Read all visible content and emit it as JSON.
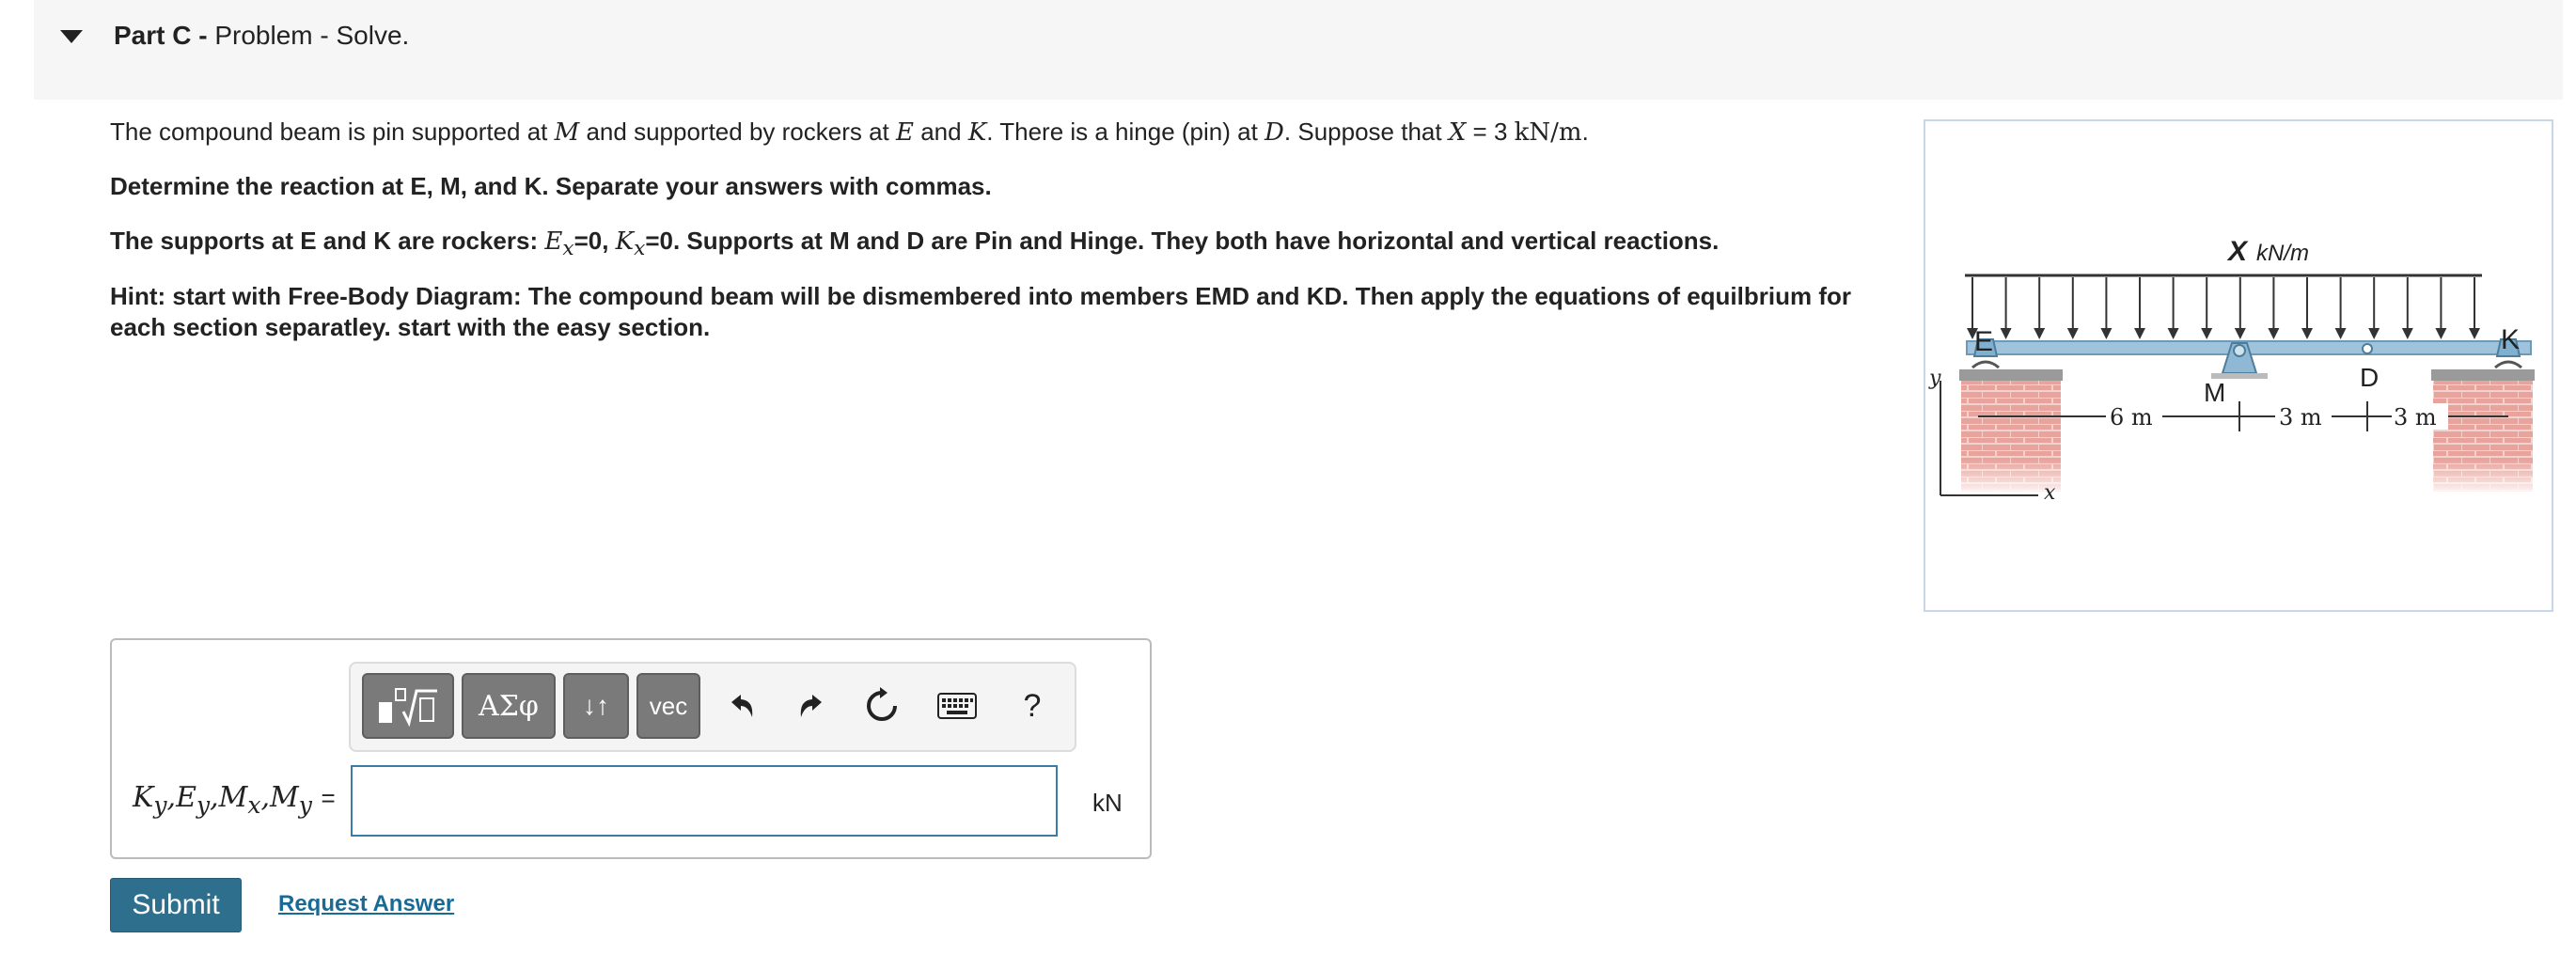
{
  "part": {
    "label": "Part C -",
    "title": "Problem - Solve."
  },
  "problem": {
    "p1_a": "The compound beam   is pin supported at ",
    "p1_M": "M",
    "p1_b": " and supported by rockers at ",
    "p1_E": "E",
    "p1_c": " and ",
    "p1_K": "K",
    "p1_d": ". There is a hinge (pin) at ",
    "p1_D": "D",
    "p1_e": ". Suppose that ",
    "p1_X": "X",
    "p1_f": " = 3 ",
    "p1_unit": "kN/m",
    "p1_g": ".",
    "p2": "Determine the reaction at E, M, and K. Separate your answers with commas.",
    "p3_a": "The supports at E and K are rockers: ",
    "p3_Ex": "E",
    "p3_Ex_sub": "x",
    "p3_b": "=0, ",
    "p3_Kx": "K",
    "p3_Kx_sub": "x",
    "p3_c": "=0. Supports at M and D are Pin and Hinge. They both have horizontal and vertical reactions.",
    "p4": "Hint: start with Free-Body Diagram: The compound beam will be dismembered into members EMD and KD. Then apply the equations of equilbrium for each section separatley. start with the easy section."
  },
  "figure": {
    "load_label_X": "X",
    "load_label_unit": "kN/m",
    "label_E": "E",
    "label_K": "K",
    "label_M": "M",
    "label_D": "D",
    "axis_y": "y",
    "axis_x": "x",
    "dim_1": "6 m",
    "dim_2": "3 m",
    "dim_3": "3 m"
  },
  "toolbar": {
    "templates_icon": "fraction-sqrt-icon",
    "greek_label": "ΑΣφ",
    "arrows_label": "↓↑",
    "vec_label": "vec",
    "help_label": "?"
  },
  "answer": {
    "label_parts": [
      "K",
      "y",
      "E",
      "y",
      "M",
      "x",
      "M",
      "y"
    ],
    "equals": "=",
    "value": "",
    "units": "kN"
  },
  "actions": {
    "submit": "Submit",
    "request": "Request Answer"
  },
  "colors": {
    "accent": "#2e6f8e",
    "input_border": "#3a7ca5",
    "beam": "#9fc3dc",
    "brick": "#e08a82"
  }
}
